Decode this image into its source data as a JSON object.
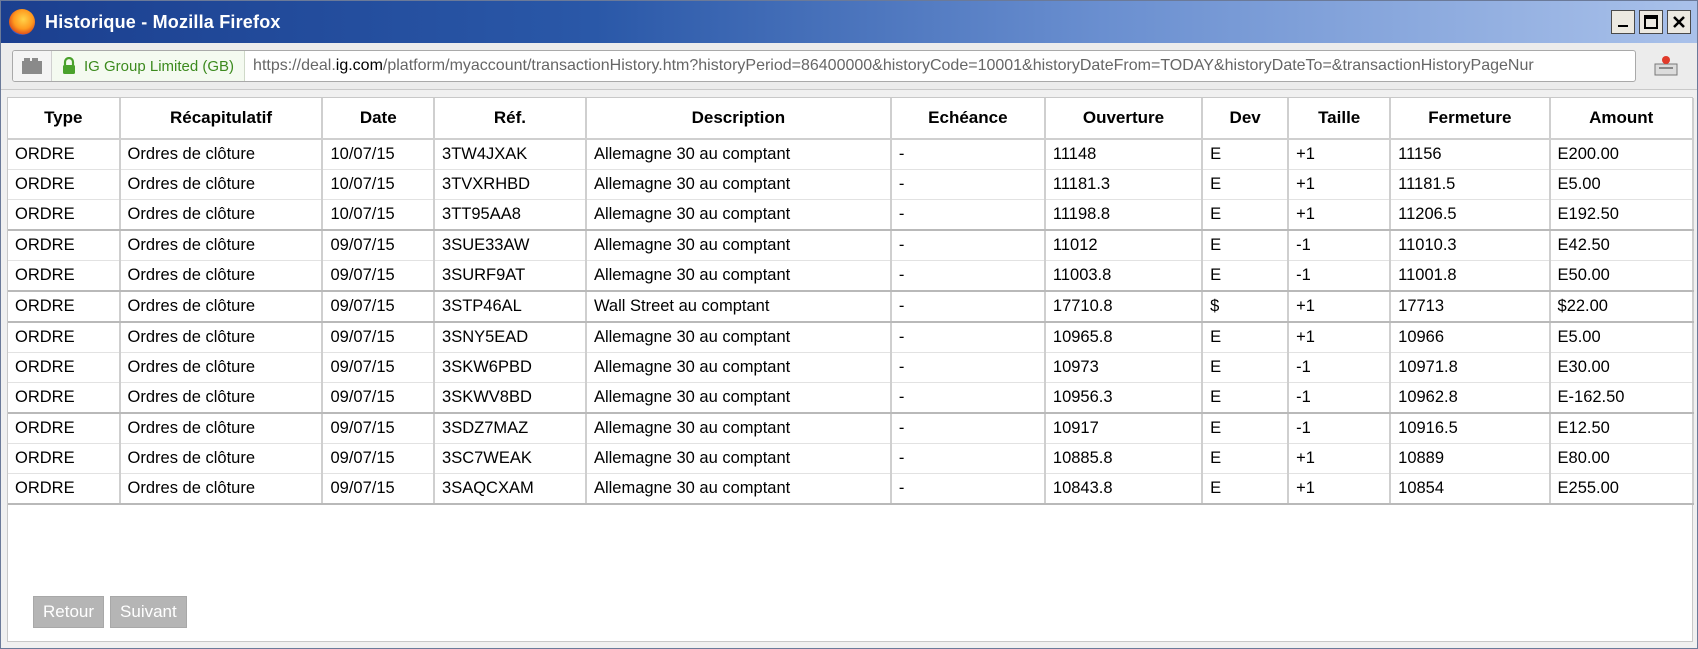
{
  "window": {
    "title": "Historique - Mozilla Firefox"
  },
  "addressbar": {
    "identity": "IG Group Limited (GB)",
    "url_prefix": "https://deal.",
    "url_domain": "ig.com",
    "url_rest": "/platform/myaccount/transactionHistory.htm?historyPeriod=86400000&historyCode=10001&historyDateFrom=TODAY&historyDateTo=&transactionHistoryPageNur"
  },
  "table": {
    "headers": [
      "Type",
      "Récapitulatif",
      "Date",
      "Réf.",
      "Description",
      "Echéance",
      "Ouverture",
      "Dev",
      "Taille",
      "Fermeture",
      "Amount"
    ],
    "rows": [
      [
        "ORDRE",
        "Ordres de clôture",
        "10/07/15",
        "3TW4JXAK",
        "Allemagne 30 au comptant",
        "-",
        "11148",
        "E",
        "+1",
        "11156",
        "E200.00"
      ],
      [
        "ORDRE",
        "Ordres de clôture",
        "10/07/15",
        "3TVXRHBD",
        "Allemagne 30 au comptant",
        "-",
        "11181.3",
        "E",
        "+1",
        "11181.5",
        "E5.00"
      ],
      [
        "ORDRE",
        "Ordres de clôture",
        "10/07/15",
        "3TT95AA8",
        "Allemagne 30 au comptant",
        "-",
        "11198.8",
        "E",
        "+1",
        "11206.5",
        "E192.50"
      ],
      [
        "ORDRE",
        "Ordres de clôture",
        "09/07/15",
        "3SUE33AW",
        "Allemagne 30 au comptant",
        "-",
        "11012",
        "E",
        "-1",
        "11010.3",
        "E42.50"
      ],
      [
        "ORDRE",
        "Ordres de clôture",
        "09/07/15",
        "3SURF9AT",
        "Allemagne 30 au comptant",
        "-",
        "11003.8",
        "E",
        "-1",
        "11001.8",
        "E50.00"
      ],
      [
        "ORDRE",
        "Ordres de clôture",
        "09/07/15",
        "3STP46AL",
        "Wall Street au comptant",
        "-",
        "17710.8",
        "$",
        "+1",
        "17713",
        "$22.00"
      ],
      [
        "ORDRE",
        "Ordres de clôture",
        "09/07/15",
        "3SNY5EAD",
        "Allemagne 30 au comptant",
        "-",
        "10965.8",
        "E",
        "+1",
        "10966",
        "E5.00"
      ],
      [
        "ORDRE",
        "Ordres de clôture",
        "09/07/15",
        "3SKW6PBD",
        "Allemagne 30 au comptant",
        "-",
        "10973",
        "E",
        "-1",
        "10971.8",
        "E30.00"
      ],
      [
        "ORDRE",
        "Ordres de clôture",
        "09/07/15",
        "3SKWV8BD",
        "Allemagne 30 au comptant",
        "-",
        "10956.3",
        "E",
        "-1",
        "10962.8",
        "E-162.50"
      ],
      [
        "ORDRE",
        "Ordres de clôture",
        "09/07/15",
        "3SDZ7MAZ",
        "Allemagne 30 au comptant",
        "-",
        "10917",
        "E",
        "-1",
        "10916.5",
        "E12.50"
      ],
      [
        "ORDRE",
        "Ordres de clôture",
        "09/07/15",
        "3SC7WEAK",
        "Allemagne 30 au comptant",
        "-",
        "10885.8",
        "E",
        "+1",
        "10889",
        "E80.00"
      ],
      [
        "ORDRE",
        "Ordres de clôture",
        "09/07/15",
        "3SAQCXAM",
        "Allemagne 30 au comptant",
        "-",
        "10843.8",
        "E",
        "+1",
        "10854",
        "E255.00"
      ]
    ]
  },
  "pager": {
    "prev_label": "Retour",
    "next_label": "Suivant"
  },
  "icons": {
    "app": "firefox-icon",
    "site": "site-identity-icon",
    "lock": "lock-icon",
    "addon": "addon-icon"
  }
}
